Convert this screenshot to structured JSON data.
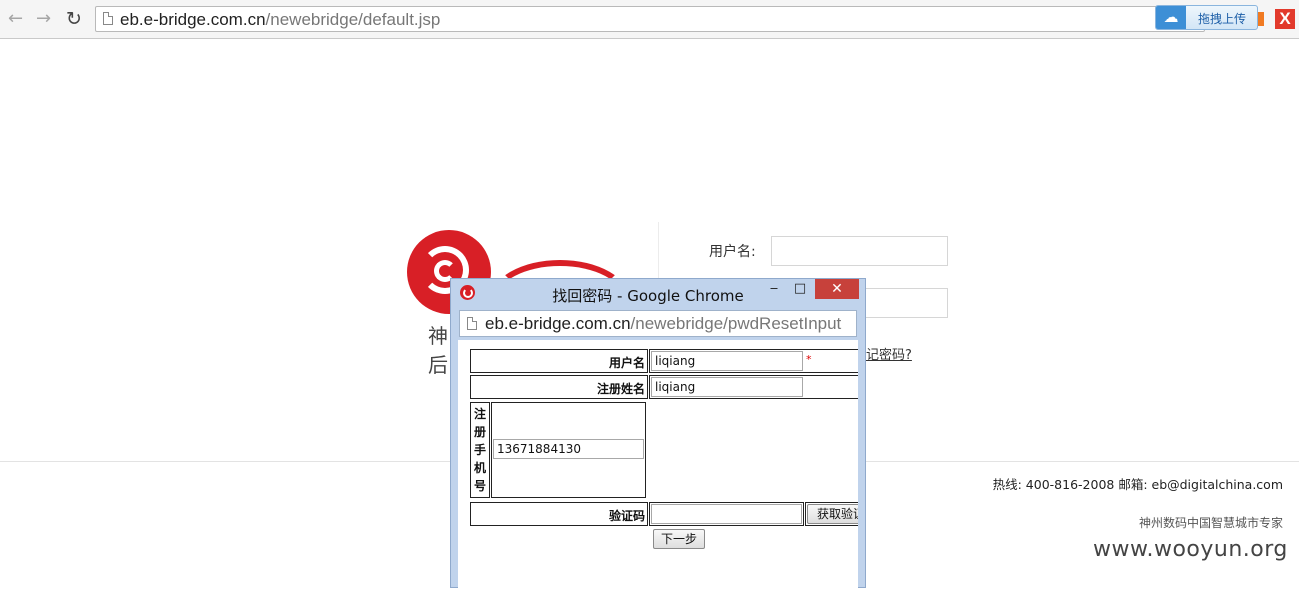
{
  "browser": {
    "url_host": "eb.e-bridge.com.cn",
    "url_path": "/newebridge/default.jsp",
    "upload_button_label": "拖拽上传",
    "close_ext_label": "X",
    "icons": [
      "back-arrow-icon",
      "forward-arrow-icon",
      "reload-icon",
      "page-icon",
      "cloud-upload-icon",
      "close-icon"
    ]
  },
  "page": {
    "logo_chars": [
      "神",
      "后"
    ],
    "login": {
      "username_label": "用户名:",
      "forgot_link": "记密码?"
    },
    "footer": {
      "contact": "热线: 400-816-2008  邮箱: eb@digitalchina.com",
      "slogan": "神州数码中国智慧城市专家"
    },
    "watermark": "www.wooyun.org"
  },
  "popup": {
    "title": "找回密码 - Google Chrome",
    "url_host": "eb.e-bridge.com.cn",
    "url_path": "/newebridge/pwdResetInput",
    "minimize_label": "‒",
    "maximize_label": "□",
    "close_label": "✕",
    "form": {
      "username_label": "用户名",
      "username_value": "liqiang",
      "required_mark": "*",
      "regname_label": "注册姓名",
      "regname_value": "liqiang",
      "phone_label_chars": [
        "注",
        "册",
        "手",
        "机",
        "号"
      ],
      "phone_value": "13671884130",
      "captcha_label": "验证码",
      "captcha_value": "",
      "get_code_button": "获取验证码",
      "next_button": "下一步"
    }
  }
}
